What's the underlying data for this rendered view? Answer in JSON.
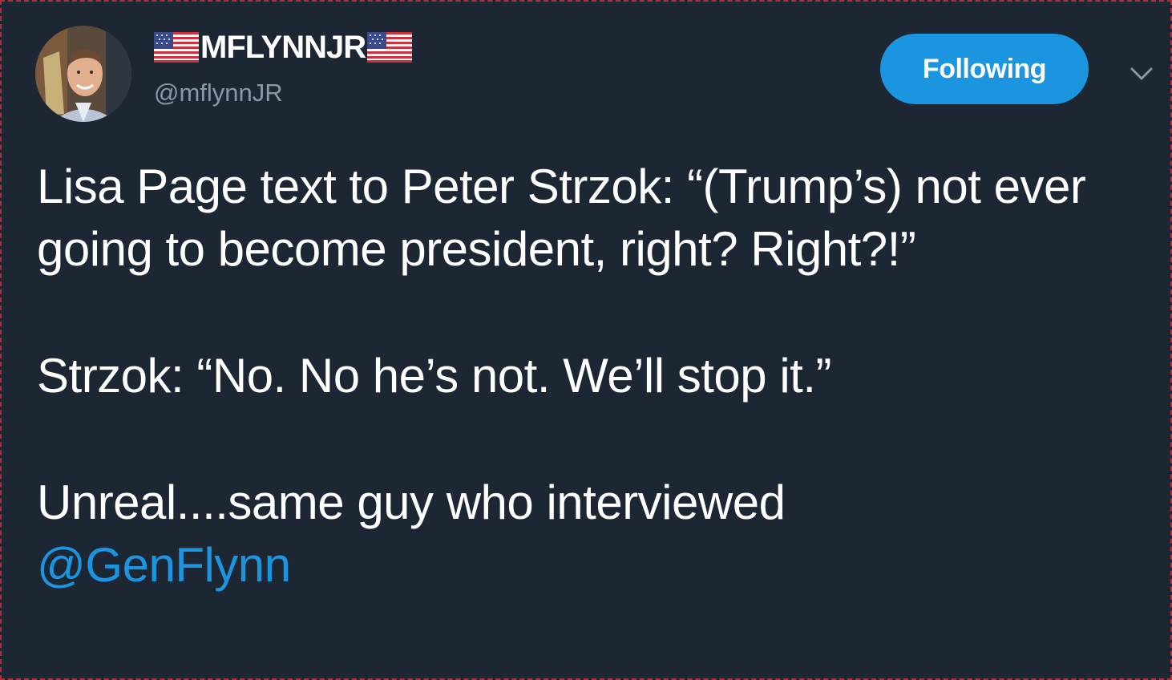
{
  "author": {
    "display_name": "MFLYNNJR",
    "handle": "@mflynnJR",
    "flag_icon": "us-flag-icon"
  },
  "follow_button": {
    "label": "Following",
    "color": "#1b95e0"
  },
  "menu": {
    "icon": "chevron-down-icon"
  },
  "tweet": {
    "line1": "Lisa Page text to Peter Strzok: “(Trump’s) not ever going to become president, right? Right?!”",
    "line2": "Strzok: “No. No he’s not. We’ll stop it.”",
    "line3": "Unreal....same guy who interviewed",
    "mention": "@GenFlynn"
  },
  "colors": {
    "background": "#1c2733",
    "text": "#ffffff",
    "secondary_text": "#8899a6",
    "link": "#1b95e0"
  }
}
